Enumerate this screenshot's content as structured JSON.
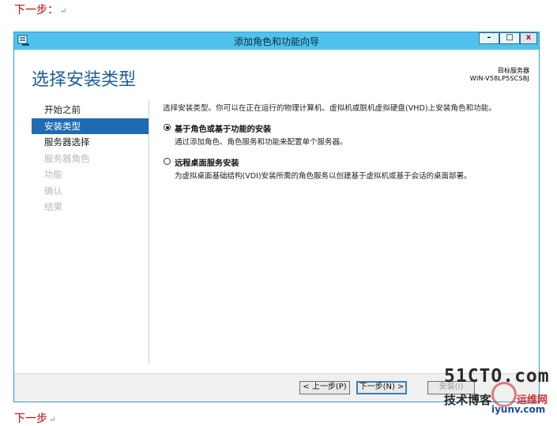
{
  "document": {
    "top_text": "下一步：",
    "bottom_text": "下一步",
    "para_mark": "↵"
  },
  "window": {
    "title": "添加角色和功能向导",
    "app_icon": "server-manager-icon",
    "minimize_label": "–",
    "maximize_label": "□",
    "close_label": "x"
  },
  "page": {
    "heading": "选择安装类型",
    "target_label": "目标服务器",
    "target_name": "WIN-V58LP5SCSBJ"
  },
  "nav": {
    "items": [
      {
        "label": "开始之前",
        "state": "normal"
      },
      {
        "label": "安装类型",
        "state": "active"
      },
      {
        "label": "服务器选择",
        "state": "normal"
      },
      {
        "label": "服务器角色",
        "state": "disabled"
      },
      {
        "label": "功能",
        "state": "disabled"
      },
      {
        "label": "确认",
        "state": "disabled"
      },
      {
        "label": "结果",
        "state": "disabled"
      }
    ]
  },
  "content": {
    "intro": "选择安装类型。你可以在正在运行的物理计算机、虚拟机或脱机虚拟硬盘(VHD)上安装角色和功能。",
    "options": [
      {
        "title": "基于角色或基于功能的安装",
        "description": "通过添加角色、角色服务和功能来配置单个服务器。",
        "checked": true
      },
      {
        "title": "远程桌面服务安装",
        "description": "为虚拟桌面基础结构(VDI)安装所需的角色服务以创建基于虚拟机或基于会话的桌面部署。",
        "checked": false
      }
    ]
  },
  "footer": {
    "prev_label": "< 上一步(P)",
    "next_label": "下一步(N) >",
    "install_label": "安装(I)"
  },
  "watermark": {
    "brand": "51CTO.com",
    "sub": "技术博客",
    "badge": "运维网",
    "site": "iyunv.com"
  },
  "colors": {
    "titlebar": "#4fc3ee",
    "heading": "#1a5f97",
    "nav_active": "#1e6bb3",
    "doc_text": "#c00000"
  }
}
